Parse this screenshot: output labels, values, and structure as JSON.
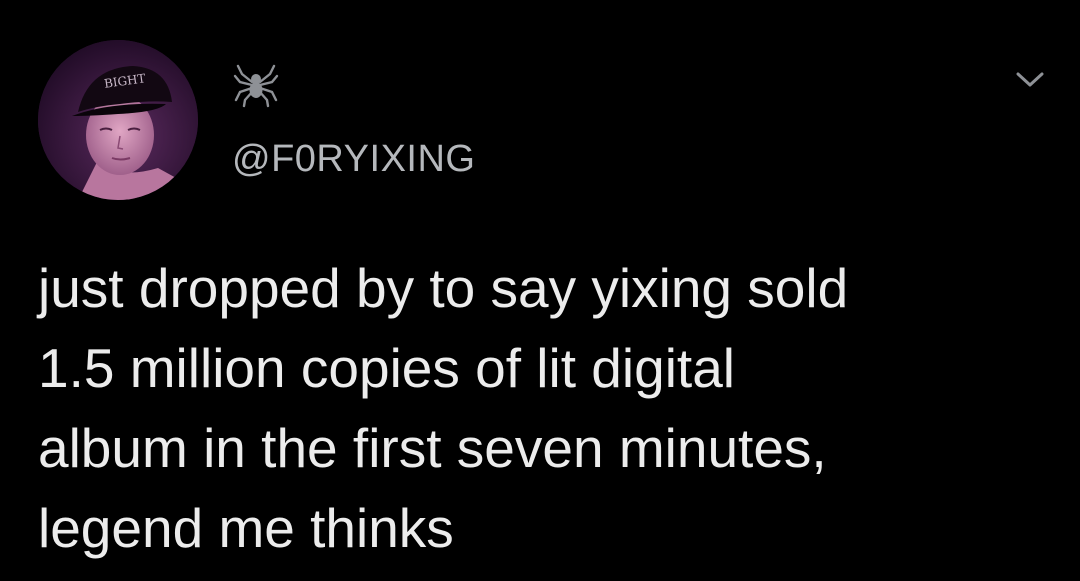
{
  "tweet": {
    "avatar_icon": "profile-photo-person-in-cap",
    "display_name_icon": "spider-icon",
    "handle": "@F0RYIXING",
    "more_icon": "chevron-down-icon",
    "text": "just dropped by to say yixing sold\n1.5 million copies of lit digital\nalbum in the first seven minutes,\nlegend me thinks"
  },
  "colors": {
    "background": "#000000",
    "text": "#ececec",
    "handle": "#b5b8bc",
    "icon": "#8e9196"
  }
}
